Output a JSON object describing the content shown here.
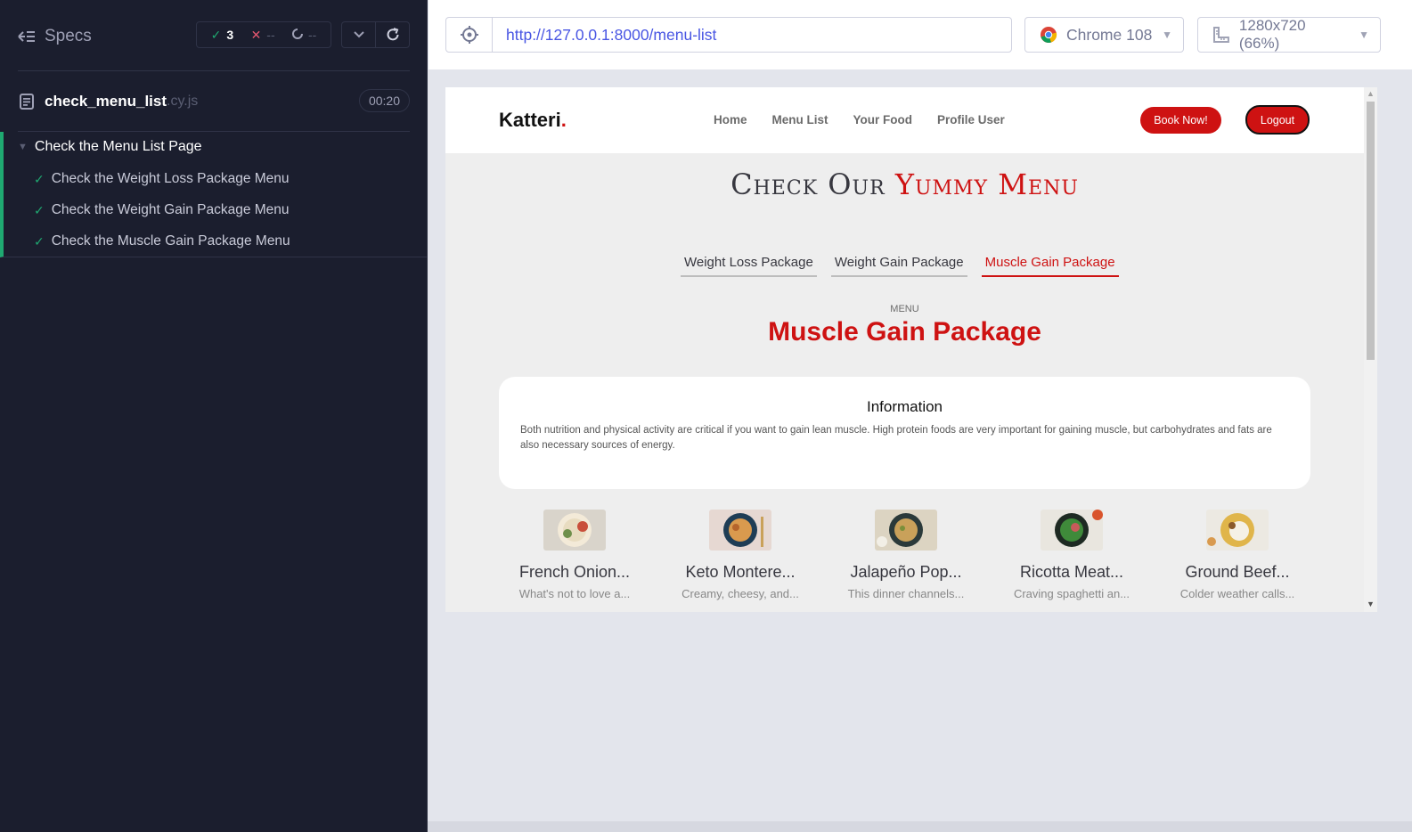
{
  "cypress": {
    "specs_label": "Specs",
    "stats": {
      "passed": "3",
      "failed": "--",
      "pending": "--"
    },
    "spec_file": {
      "name": "check_menu_list",
      "ext": ".cy.js",
      "duration": "00:20"
    },
    "suite": {
      "title": "Check the Menu List Page",
      "tests": [
        {
          "title": "Check the Weight Loss Package Menu",
          "state": "passed"
        },
        {
          "title": "Check the Weight Gain Package Menu",
          "state": "passed"
        },
        {
          "title": "Check the Muscle Gain Package Menu",
          "state": "passed"
        }
      ]
    }
  },
  "browser_bar": {
    "url": "http://127.0.0.1:8000/menu-list",
    "browser": "Chrome 108",
    "viewport": "1280x720 (66%)"
  },
  "site": {
    "logo": "Katteri",
    "logo_dot": ".",
    "nav": [
      "Home",
      "Menu List",
      "Your Food",
      "Profile User"
    ],
    "book_button": "Book Now!",
    "logout_button": "Logout",
    "section_title_plain": "Check Our",
    "section_title_accent": "Yummy Menu",
    "tabs": [
      {
        "label": "Weight Loss Package",
        "active": false
      },
      {
        "label": "Weight Gain Package",
        "active": false
      },
      {
        "label": "Muscle Gain Package",
        "active": true
      }
    ],
    "menu_kicker": "MENU",
    "menu_heading": "Muscle Gain Package",
    "info": {
      "title": "Information",
      "body": "Both nutrition and physical activity are critical if you want to gain lean muscle. High protein foods are very important for gaining muscle, but carbohydrates and fats are also necessary sources of energy."
    },
    "foods": [
      {
        "name": "French Onion...",
        "desc": "What's not to love a...",
        "plate": "#f3ead8",
        "accent": "#c94f3a"
      },
      {
        "name": "Keto Montere...",
        "desc": "Creamy, cheesy, and...",
        "plate": "#1f3d55",
        "accent": "#d99a4e"
      },
      {
        "name": "Jalapeño Pop...",
        "desc": "This dinner channels...",
        "plate": "#2b3a3a",
        "accent": "#c9a15a"
      },
      {
        "name": "Ricotta Meat...",
        "desc": "Craving spaghetti an...",
        "plate": "#1e2a22",
        "accent": "#3f8a3a"
      },
      {
        "name": "Ground Beef...",
        "desc": "Colder weather calls...",
        "plate": "#e0b54a",
        "accent": "#f5f1e6"
      }
    ]
  },
  "colors": {
    "panel_bg": "#1b1e2e",
    "pass": "#1fa971",
    "brand_red": "#ce1212",
    "url_blue": "#4956e3"
  }
}
